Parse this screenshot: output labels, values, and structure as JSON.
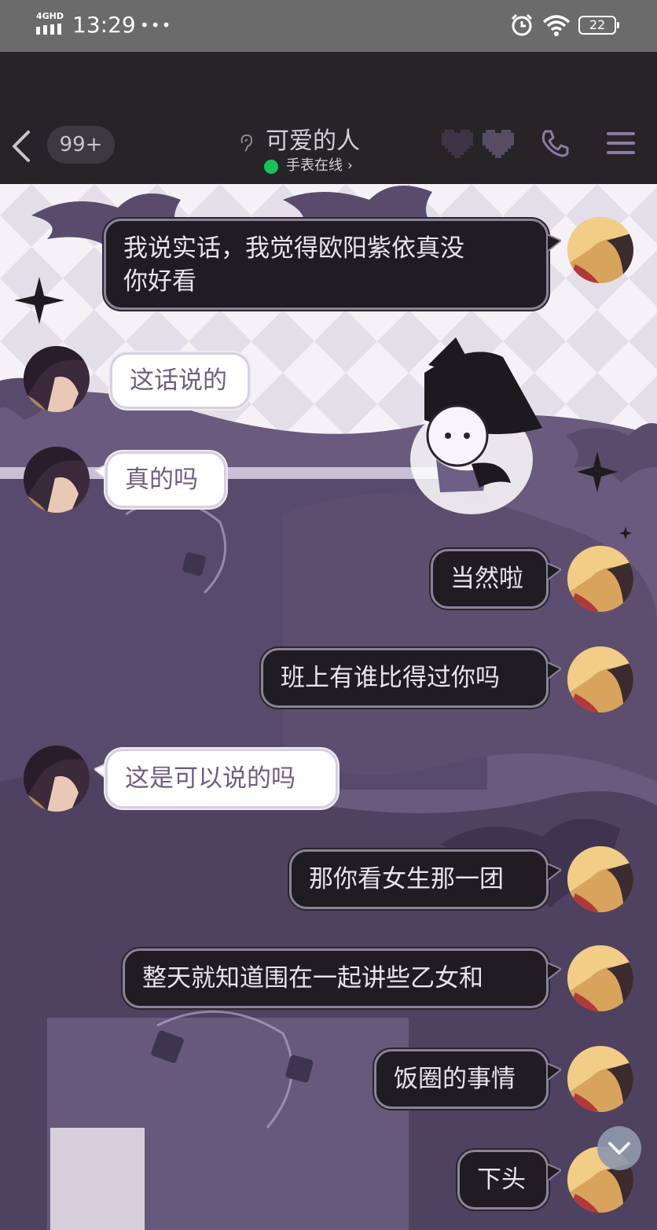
{
  "status_bar": {
    "network": "4GHD",
    "time": "13:29",
    "dots": "•••",
    "battery": "22"
  },
  "header": {
    "unread_count": "99+",
    "contact_name": "可爱的人",
    "online_status": "手表在线 ›"
  },
  "messages": [
    {
      "side": "out",
      "lines": [
        "我说实话，我觉得欧阳紫依真没",
        "你好看"
      ]
    },
    {
      "side": "in",
      "lines": [
        "这话说的"
      ]
    },
    {
      "side": "in",
      "lines": [
        "真的吗"
      ]
    },
    {
      "side": "out",
      "lines": [
        "当然啦"
      ]
    },
    {
      "side": "out",
      "lines": [
        "班上有谁比得过你吗"
      ]
    },
    {
      "side": "in",
      "lines": [
        "这是可以说的吗"
      ]
    },
    {
      "side": "out",
      "lines": [
        "那你看女生那一团"
      ]
    },
    {
      "side": "out",
      "lines": [
        "整天就知道围在一起讲些乙女和"
      ]
    },
    {
      "side": "out",
      "lines": [
        "饭圈的事情"
      ]
    },
    {
      "side": "out",
      "lines": [
        "下头"
      ]
    }
  ],
  "colors": {
    "accent_purple": "#5a4d6b",
    "online_green": "#19c15a",
    "dark_bubble": "#1f1c22"
  },
  "icons": {
    "back": "back-icon",
    "hearts": "pixel-heart-icon",
    "call": "phone-icon",
    "menu": "menu-icon",
    "scroll": "chevron-down-icon"
  }
}
